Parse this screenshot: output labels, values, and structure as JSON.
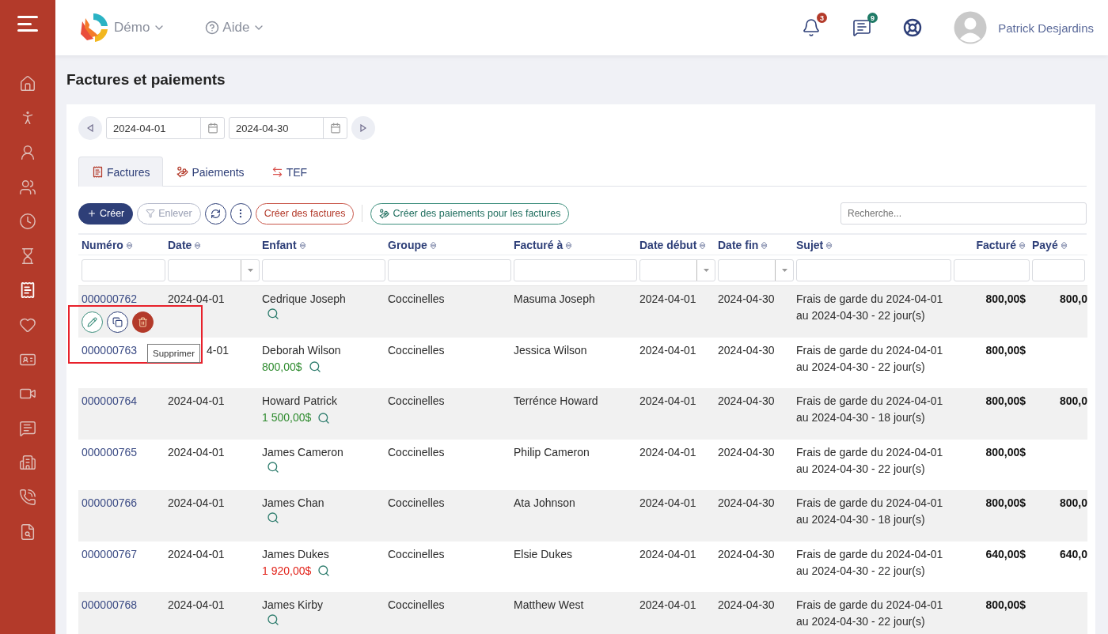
{
  "sidebar": {
    "items": [
      {
        "selected": false
      },
      {
        "selected": false
      },
      {
        "selected": false
      },
      {
        "selected": false
      },
      {
        "selected": false
      },
      {
        "selected": false
      },
      {
        "selected": true
      },
      {
        "selected": false
      },
      {
        "selected": false
      },
      {
        "selected": false
      },
      {
        "selected": false
      },
      {
        "selected": false
      },
      {
        "selected": false
      },
      {
        "selected": false
      }
    ]
  },
  "header": {
    "org": "Démo",
    "help": "Aide",
    "notifications": "3",
    "messages": "9",
    "user": "Patrick Desjardins"
  },
  "page_title": "Factures et paiements",
  "date_range": {
    "start": "2024-04-01",
    "end": "2024-04-30"
  },
  "tabs": [
    {
      "label": "Factures",
      "selected": true
    },
    {
      "label": "Paiements",
      "selected": false
    },
    {
      "label": "TEF",
      "selected": false
    }
  ],
  "toolbar": {
    "create": "Créer",
    "remove": "Enlever",
    "remove_disabled": true,
    "create_invoices": "Créer des factures",
    "create_payments": "Créer des paiements pour les factures",
    "search_placeholder": "Recherche..."
  },
  "table": {
    "columns": [
      {
        "label": "Numéro",
        "kind": "text"
      },
      {
        "label": "Date",
        "kind": "date"
      },
      {
        "label": "Enfant",
        "kind": "text"
      },
      {
        "label": "Groupe",
        "kind": "text"
      },
      {
        "label": "Facturé à",
        "kind": "text"
      },
      {
        "label": "Date début",
        "kind": "date"
      },
      {
        "label": "Date fin",
        "kind": "date"
      },
      {
        "label": "Sujet",
        "kind": "text"
      },
      {
        "label": "Facturé",
        "kind": "amount"
      },
      {
        "label": "Payé",
        "kind": "amount"
      }
    ],
    "rows": [
      {
        "number": "000000762",
        "date": "2024-04-01",
        "child": "Cedrique Joseph",
        "group": "Coccinelles",
        "billed_to": "Masuma Joseph",
        "start": "2024-04-01",
        "end": "2024-04-30",
        "subject": "Frais de garde du 2024-04-01 au 2024-04-30 - 22 jour(s)",
        "billed": "800,00$",
        "paid": "800,0",
        "actions": {
          "tooltip": "Supprimer"
        }
      },
      {
        "number": "000000763",
        "date": "4-01",
        "child": "Deborah Wilson",
        "amount": {
          "text": "800,00$",
          "color": "#2e8b2e"
        },
        "group": "Coccinelles",
        "billed_to": "Jessica Wilson",
        "start": "2024-04-01",
        "end": "2024-04-30",
        "subject": "Frais de garde du 2024-04-01 au 2024-04-30 - 22 jour(s)",
        "billed": "800,00$"
      },
      {
        "number": "000000764",
        "date": "2024-04-01",
        "child": "Howard Patrick",
        "amount": {
          "text": "1 500,00$",
          "color": "#2e8b2e"
        },
        "group": "Coccinelles",
        "billed_to": "Terrénce Howard",
        "start": "2024-04-01",
        "end": "2024-04-30",
        "subject": "Frais de garde du 2024-04-01 au 2024-04-30 - 18 jour(s)",
        "billed": "800,00$",
        "paid": "800,0"
      },
      {
        "number": "000000765",
        "date": "2024-04-01",
        "child": "James Cameron",
        "group": "Coccinelles",
        "billed_to": "Philip Cameron",
        "start": "2024-04-01",
        "end": "2024-04-30",
        "subject": "Frais de garde du 2024-04-01 au 2024-04-30 - 22 jour(s)",
        "billed": "800,00$"
      },
      {
        "number": "000000766",
        "date": "2024-04-01",
        "child": "James Chan",
        "group": "Coccinelles",
        "billed_to": "Ata Johnson",
        "start": "2024-04-01",
        "end": "2024-04-30",
        "subject": "Frais de garde du 2024-04-01 au 2024-04-30 - 18 jour(s)",
        "billed": "800,00$",
        "paid": "800,0"
      },
      {
        "number": "000000767",
        "date": "2024-04-01",
        "child": "James Dukes",
        "amount": {
          "text": "1 920,00$",
          "color": "#e2231a"
        },
        "group": "Coccinelles",
        "billed_to": "Elsie Dukes",
        "start": "2024-04-01",
        "end": "2024-04-30",
        "subject": "Frais de garde du 2024-04-01 au 2024-04-30 - 22 jour(s)",
        "billed": "640,00$",
        "paid": "640,0"
      },
      {
        "number": "000000768",
        "date": "2024-04-01",
        "child": "James Kirby",
        "group": "Coccinelles",
        "billed_to": "Matthew West",
        "start": "2024-04-01",
        "end": "2024-04-30",
        "subject": "Frais de garde du 2024-04-01 au 2024-04-30 - 22 jour(s)",
        "billed": "800,00$"
      }
    ]
  }
}
